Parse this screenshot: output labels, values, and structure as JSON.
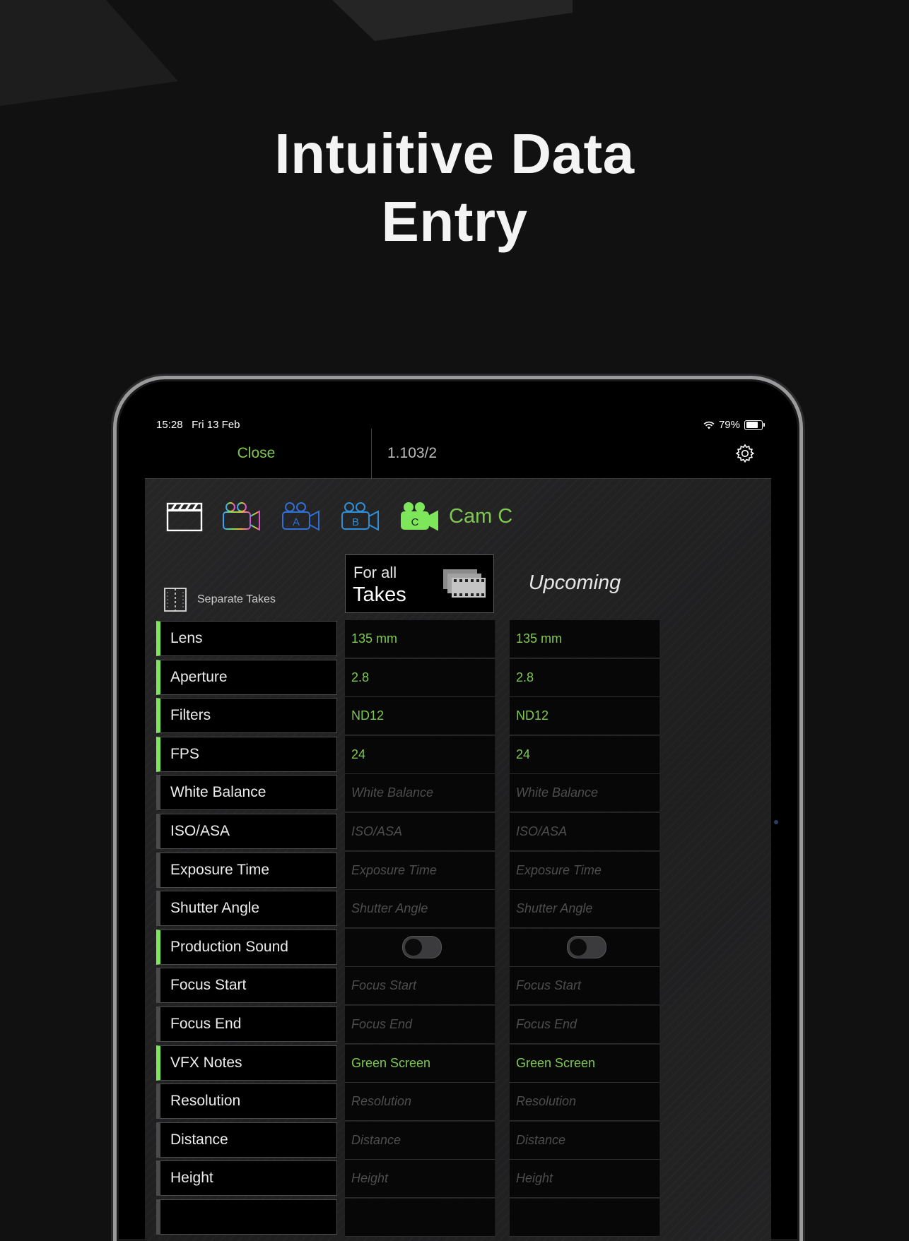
{
  "headline": {
    "line1": "Intuitive Data",
    "line2": "Entry"
  },
  "status_bar": {
    "time": "15:28",
    "date": "Fri 13 Feb",
    "battery": "79%"
  },
  "nav": {
    "close_label": "Close",
    "take_id": "1.103/2"
  },
  "camera_tabs": {
    "icons": [
      "clapperboard-icon",
      "camera-multicolor-icon",
      "camera-a-icon",
      "camera-b-icon",
      "camera-c-icon"
    ],
    "cam_a_letter": "A",
    "cam_b_letter": "B",
    "cam_c_letter": "C",
    "selected_label": "Cam C",
    "colors": {
      "accent": "#7dc94f",
      "cam_a": "#2f6fd6",
      "cam_b": "#2e8fd8"
    }
  },
  "separate_takes": {
    "label": "Separate Takes"
  },
  "columns": {
    "for_all_line1": "For all",
    "for_all_line2": "Takes",
    "upcoming": "Upcoming"
  },
  "rows": [
    {
      "label": "Lens",
      "active": true,
      "for_all": "135 mm",
      "upcoming": "135 mm",
      "type": "value"
    },
    {
      "label": "Aperture",
      "active": true,
      "for_all": "2.8",
      "upcoming": "2.8",
      "type": "value"
    },
    {
      "label": "Filters",
      "active": true,
      "for_all": "ND12",
      "upcoming": "ND12",
      "type": "value"
    },
    {
      "label": "FPS",
      "active": true,
      "for_all": "24",
      "upcoming": "24",
      "type": "value"
    },
    {
      "label": "White Balance",
      "active": false,
      "for_all": "White Balance",
      "upcoming": "White Balance",
      "type": "placeholder"
    },
    {
      "label": "ISO/ASA",
      "active": false,
      "for_all": "ISO/ASA",
      "upcoming": "ISO/ASA",
      "type": "placeholder"
    },
    {
      "label": "Exposure Time",
      "active": false,
      "for_all": "Exposure Time",
      "upcoming": "Exposure Time",
      "type": "placeholder"
    },
    {
      "label": "Shutter Angle",
      "active": false,
      "for_all": "Shutter Angle",
      "upcoming": "Shutter Angle",
      "type": "placeholder"
    },
    {
      "label": "Production Sound",
      "active": true,
      "for_all": "",
      "upcoming": "",
      "type": "toggle"
    },
    {
      "label": "Focus Start",
      "active": false,
      "for_all": "Focus Start",
      "upcoming": "Focus Start",
      "type": "placeholder"
    },
    {
      "label": "Focus End",
      "active": false,
      "for_all": "Focus End",
      "upcoming": "Focus End",
      "type": "placeholder"
    },
    {
      "label": "VFX Notes",
      "active": true,
      "for_all": "Green Screen",
      "upcoming": "Green Screen",
      "type": "value"
    },
    {
      "label": "Resolution",
      "active": false,
      "for_all": "Resolution",
      "upcoming": "Resolution",
      "type": "placeholder"
    },
    {
      "label": "Distance",
      "active": false,
      "for_all": "Distance",
      "upcoming": "Distance",
      "type": "placeholder"
    },
    {
      "label": "Height",
      "active": false,
      "for_all": "Height",
      "upcoming": "Height",
      "type": "placeholder"
    },
    {
      "label": "",
      "active": false,
      "for_all": "",
      "upcoming": "",
      "type": "placeholder"
    }
  ]
}
